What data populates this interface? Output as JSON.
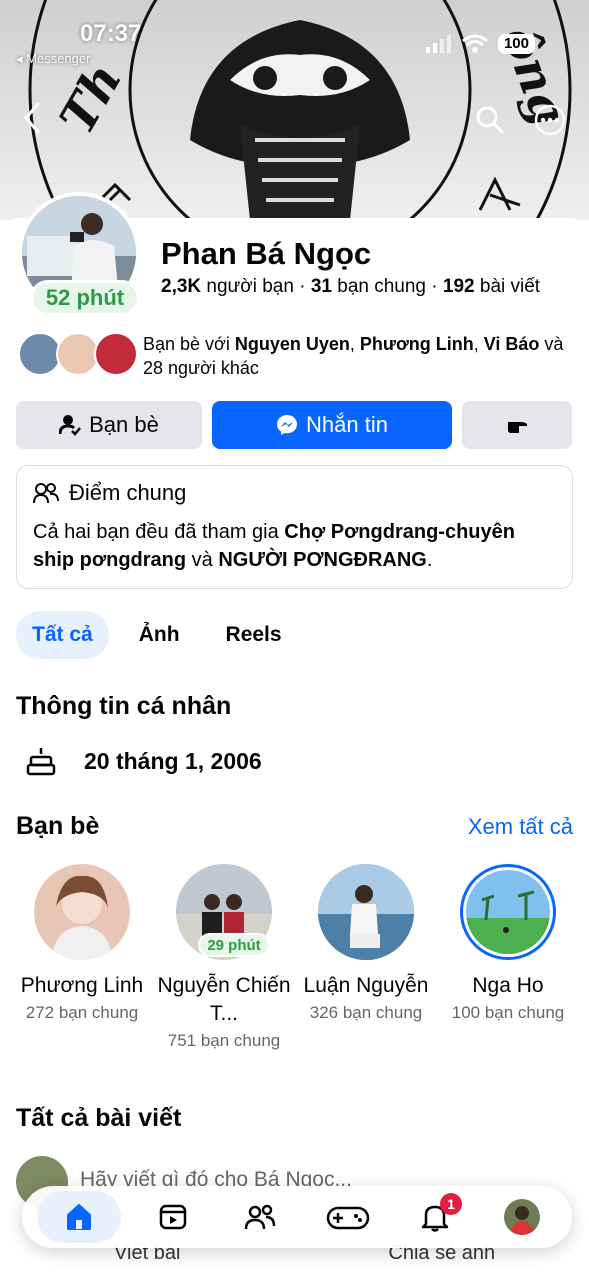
{
  "status_bar": {
    "time": "07:37",
    "back_app": "◂ Messenger",
    "battery": "100"
  },
  "profile": {
    "name": "Phan Bá Ngọc",
    "active_time": "52 phút",
    "stats": {
      "friends_count": "2,3K",
      "friends_label": "người bạn",
      "mutual_count": "31",
      "mutual_label": "bạn chung",
      "posts_count": "192",
      "posts_label": "bài viết"
    },
    "mutual_friends": {
      "prefix": "Bạn bè với ",
      "names": "Nguyen Uyen",
      "sep1": ", ",
      "name2": "Phương Linh",
      "sep2": ", ",
      "name3": "Vi Báo",
      "suffix": " và 28 người khác"
    }
  },
  "actions": {
    "friends_label": "Bạn bè",
    "message_label": "Nhắn tin"
  },
  "common": {
    "title": "Điểm chung",
    "text_prefix": "Cả hai bạn đều đã tham gia ",
    "group1": "Chợ Pơngdrang-chuyên ship pơngdrang",
    "text_mid": " và ",
    "group2": "NGƯỜI PƠNGĐRANG",
    "text_suffix": "."
  },
  "tabs": [
    {
      "label": "Tất cả",
      "active": true
    },
    {
      "label": "Ảnh"
    },
    {
      "label": "Reels"
    }
  ],
  "about": {
    "title": "Thông tin cá nhân",
    "birthday": "20 tháng 1, 2006"
  },
  "friends": {
    "title": "Bạn bè",
    "see_all": "Xem tất cả",
    "items": [
      {
        "name": "Phương Linh",
        "mutual": "272 bạn chung"
      },
      {
        "name": "Nguyễn Chiến T...",
        "mutual": "751 bạn chung",
        "active_time": "29 phút"
      },
      {
        "name": "Luận Nguyễn",
        "mutual": "326 bạn chung"
      },
      {
        "name": "Nga Ho",
        "mutual": "100 bạn chung"
      }
    ]
  },
  "posts": {
    "title": "Tất cả bài viết",
    "composer_hint": "Hãy viết gì đó cho Bá Ngọc...",
    "write_post": "Viết bài",
    "share_photo": "Chia sẻ ảnh"
  },
  "tabbar": {
    "notification_count": "1"
  },
  "colors": {
    "accent": "#0866ff",
    "active_green": "#2e9b45",
    "notification": "#e41e3f"
  }
}
